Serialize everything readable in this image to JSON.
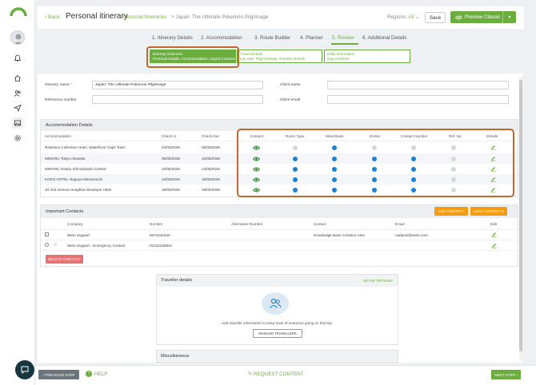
{
  "header": {
    "back": "Back",
    "title": "Personal itinerary",
    "crumb_link": "Personal Itineraries",
    "crumb_current": "Japan: The Ultimate Pokemon Pilgrimage",
    "regions_label": "Regions:",
    "regions_value": "All",
    "save": "Save",
    "preview": "Preview Classic"
  },
  "steps": [
    {
      "label": "1. Itinerary Details"
    },
    {
      "label": "2. Accommodation"
    },
    {
      "label": "3. Route Builder"
    },
    {
      "label": "4. Planner"
    },
    {
      "label": "5. Review"
    },
    {
      "label": "6. Additional Details"
    }
  ],
  "subtabs": [
    {
      "title": "Itinerary Overview",
      "desc": "Personal Details, Accommodation, Import Contacts"
    },
    {
      "title": "Travel Details",
      "desc": "Car Hire, Flight Details, Transfer Details"
    },
    {
      "title": "Daily Information",
      "desc": "Day Activities"
    }
  ],
  "form": {
    "itinerary_name_label": "Itinerary name",
    "itinerary_name_value": "Japan: The Ultimate Pokemon Pilgrimage",
    "reference_label": "Reference number",
    "client_name_label": "Client name",
    "client_email_label": "Client email"
  },
  "accommodation": {
    "title": "Accommodation Details",
    "headers": [
      "Accommodation",
      "Check In",
      "Check Out",
      "Content",
      "Room Type",
      "Meal Basis",
      "Drinks",
      "Contact Number",
      "Ref. No.",
      "Details"
    ],
    "rows": [
      {
        "name": "Radisson Collection Hotel, Waterfront Cape Town",
        "in": "04/05/2026",
        "out": "05/05/2026",
        "flags": [
          0,
          1,
          0,
          0,
          0
        ]
      },
      {
        "name": "MIMARU Tokyo Akasaka",
        "in": "05/05/2026",
        "out": "10/05/2026",
        "flags": [
          1,
          1,
          1,
          1,
          0
        ]
      },
      {
        "name": "MIMARU Osaka Shinsaibashi Central",
        "in": "10/05/2026",
        "out": "14/05/2026",
        "flags": [
          1,
          1,
          1,
          1,
          0
        ]
      },
      {
        "name": "KOKO HOTEL Nagoya Marunouchi",
        "in": "14/05/2026",
        "out": "18/05/2026",
        "flags": [
          1,
          1,
          1,
          1,
          0
        ]
      },
      {
        "name": "33 2nd Avenue Houghton Boutique Hotel",
        "in": "18/05/2026",
        "out": "19/05/2026",
        "flags": [
          1,
          1,
          1,
          1,
          0
        ]
      }
    ]
  },
  "contacts": {
    "title": "Important Contacts",
    "add": "ADD CONTACT",
    "load": "LOAD CONTACTS",
    "headers": [
      "Company",
      "Number",
      "Alternative Number",
      "Contact",
      "Email",
      "Edit"
    ],
    "rows": [
      {
        "company": "Wetu Support",
        "number": "0673442340",
        "alt": "",
        "contact": "Knowledge Base Creation User",
        "email": "nadanel@wetu.com"
      },
      {
        "company": "Wetu Support - Emergency Contact",
        "number": "02134425824",
        "alt": "",
        "contact": "",
        "email": ""
      }
    ],
    "delete": "DELETE CONTACT"
  },
  "traveller": {
    "title": "Traveller details",
    "setup": "SETUP OPTIONS",
    "message": "Add traveller information to keep track of everyone going on this trip.",
    "manage": "MANAGE TRAVELLERS"
  },
  "misc": {
    "title": "Miscellaneous"
  },
  "footer": {
    "prev": "PREVIOUS STEP",
    "help": "HELP",
    "request": "REQUEST CONTENT",
    "next": "NEXT STEP"
  },
  "colors": {
    "accent": "#6cae3e",
    "highlight": "#c1682e",
    "dot_on": "#1b82d1",
    "orange": "#f39c12"
  }
}
